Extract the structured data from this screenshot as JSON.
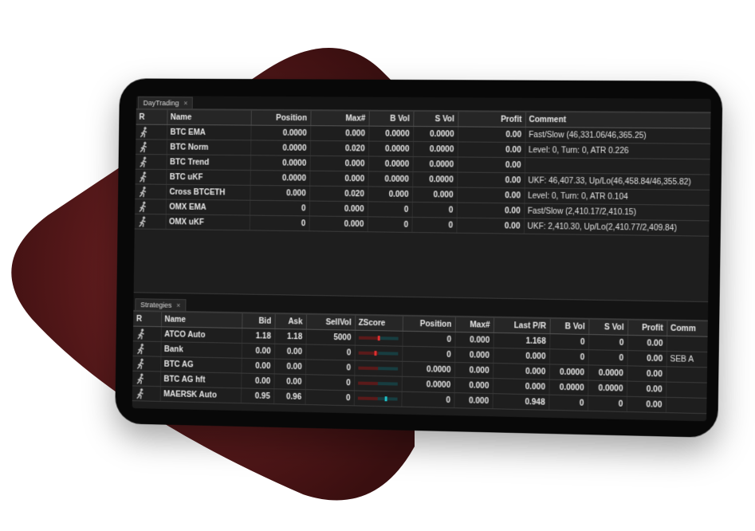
{
  "colors": {
    "shape_outer": "#3a0f10",
    "shape_inner": "#7a2426",
    "screen_bg": "#1c1c1c",
    "zscore_red": "#e03030",
    "zscore_teal": "#20c0c8"
  },
  "daytrading": {
    "tab_label": "DayTrading",
    "close_label": "×",
    "columns": [
      "R",
      "Name",
      "Position",
      "Max#",
      "B Vol",
      "S Vol",
      "Profit",
      "Comment"
    ],
    "rows": [
      {
        "icon": "running-person-icon",
        "name": "BTC EMA",
        "position": "0.0000",
        "max": "0.000",
        "bvol": "0.0000",
        "svol": "0.0000",
        "profit": "0.00",
        "comment": "Fast/Slow (46,331.06/46,365.25)"
      },
      {
        "icon": "running-person-icon",
        "name": "BTC Norm",
        "position": "0.0000",
        "max": "0.020",
        "bvol": "0.0000",
        "svol": "0.0000",
        "profit": "0.00",
        "comment": "Level: 0, Turn: 0, ATR 0.226"
      },
      {
        "icon": "running-person-icon",
        "name": "BTC Trend",
        "position": "0.0000",
        "max": "0.000",
        "bvol": "0.0000",
        "svol": "0.0000",
        "profit": "0.00",
        "comment": ""
      },
      {
        "icon": "running-person-icon",
        "name": "BTC uKF",
        "position": "0.0000",
        "max": "0.000",
        "bvol": "0.0000",
        "svol": "0.0000",
        "profit": "0.00",
        "comment": "UKF: 46,407.33, Up/Lo(46,458.84/46,355.82)"
      },
      {
        "icon": "running-person-icon",
        "name": "Cross BTCETH",
        "position": "0.000",
        "max": "0.020",
        "bvol": "0.000",
        "svol": "0.000",
        "profit": "0.00",
        "comment": "Level: 0, Turn: 0, ATR 0.104"
      },
      {
        "icon": "running-person-icon",
        "name": "OMX EMA",
        "position": "0",
        "max": "0.000",
        "bvol": "0",
        "svol": "0",
        "profit": "0.00",
        "comment": "Fast/Slow (2,410.17/2,410.15)"
      },
      {
        "icon": "running-person-icon",
        "name": "OMX uKF",
        "position": "0",
        "max": "0.000",
        "bvol": "0",
        "svol": "0",
        "profit": "0.00",
        "comment": "UKF: 2,410.30, Up/Lo(2,410.77/2,409.84)"
      }
    ]
  },
  "strategies": {
    "tab_label": "Strategies",
    "close_label": "×",
    "columns": [
      "R",
      "Name",
      "Bid",
      "Ask",
      "SellVol",
      "ZScore",
      "Position",
      "Max#",
      "Last P/R",
      "B Vol",
      "S Vol",
      "Profit",
      "Comm"
    ],
    "rows": [
      {
        "icon": "running-person-icon",
        "name": "ATCO Auto",
        "bid": "1.18",
        "ask": "1.18",
        "sellvol": "5000",
        "zscore": 0.0,
        "zcolor": "#e03030",
        "position": "0",
        "max": "0.000",
        "lastpr": "1.168",
        "bvol": "0",
        "svol": "0",
        "profit": "0.00",
        "comment": ""
      },
      {
        "icon": "running-person-icon",
        "name": "Bank",
        "bid": "0.00",
        "ask": "0.00",
        "sellvol": "0",
        "zscore": -0.1,
        "zcolor": "#e03030",
        "position": "0",
        "max": "0.000",
        "lastpr": "0.000",
        "bvol": "0",
        "svol": "0",
        "profit": "0.00",
        "comment": "SEB A"
      },
      {
        "icon": "running-person-icon",
        "name": "BTC AG",
        "bid": "0.00",
        "ask": "0.00",
        "sellvol": "0",
        "zscore": null,
        "zcolor": "",
        "position": "0.0000",
        "max": "0.000",
        "lastpr": "0.000",
        "bvol": "0.0000",
        "svol": "0.0000",
        "profit": "0.00",
        "comment": ""
      },
      {
        "icon": "running-person-icon",
        "name": "BTC AG hft",
        "bid": "0.00",
        "ask": "0.00",
        "sellvol": "0",
        "zscore": null,
        "zcolor": "",
        "position": "0.0000",
        "max": "0.000",
        "lastpr": "0.000",
        "bvol": "0.0000",
        "svol": "0.0000",
        "profit": "0.00",
        "comment": ""
      },
      {
        "icon": "running-person-icon",
        "name": "MAERSK Auto",
        "bid": "0.95",
        "ask": "0.96",
        "sellvol": "0",
        "zscore": 0.25,
        "zcolor": "#20c0c8",
        "position": "0",
        "max": "0.000",
        "lastpr": "0.948",
        "bvol": "0",
        "svol": "0",
        "profit": "0.00",
        "comment": ""
      }
    ]
  }
}
